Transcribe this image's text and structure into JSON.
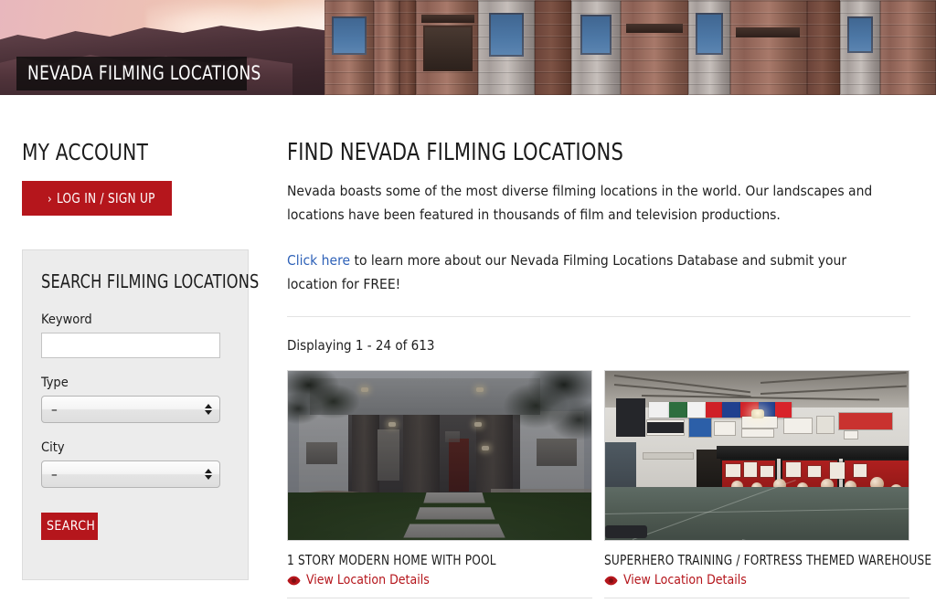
{
  "hero": {
    "title": "NEVADA FILMING LOCATIONS"
  },
  "sidebar": {
    "account_title": "MY ACCOUNT",
    "login_chevron": "›",
    "login_label": "LOG IN / SIGN UP",
    "search_panel": {
      "title": "SEARCH FILMING LOCATIONS",
      "keyword_label": "Keyword",
      "keyword_value": "",
      "keyword_placeholder": "",
      "type_label": "Type",
      "type_value": "–",
      "city_label": "City",
      "city_value": "–",
      "search_label": "SEARCH"
    }
  },
  "main": {
    "title": "FIND NEVADA FILMING LOCATIONS",
    "intro": "Nevada boasts some of the most diverse filming locations in the world. Our landscapes and locations have been featured in thousands of film and television productions.",
    "cta_link": "Click here",
    "cta_rest": " to learn more about our Nevada Filming Locations Database and submit your location for FREE!",
    "results_count": "Displaying 1 - 24 of 613",
    "cards": [
      {
        "title": "1 STORY MODERN HOME WITH POOL",
        "details_label": "View Location Details",
        "icon": "eye-icon"
      },
      {
        "title": "SUPERHERO TRAINING / FORTRESS THEMED WAREHOUSE",
        "details_label": "View Location Details",
        "icon": "eye-icon"
      }
    ]
  },
  "colors": {
    "brand_red": "#b5161c",
    "link_blue": "#2f62b8",
    "panel_grey": "#ececec",
    "text_dark": "#1c1c1c"
  }
}
